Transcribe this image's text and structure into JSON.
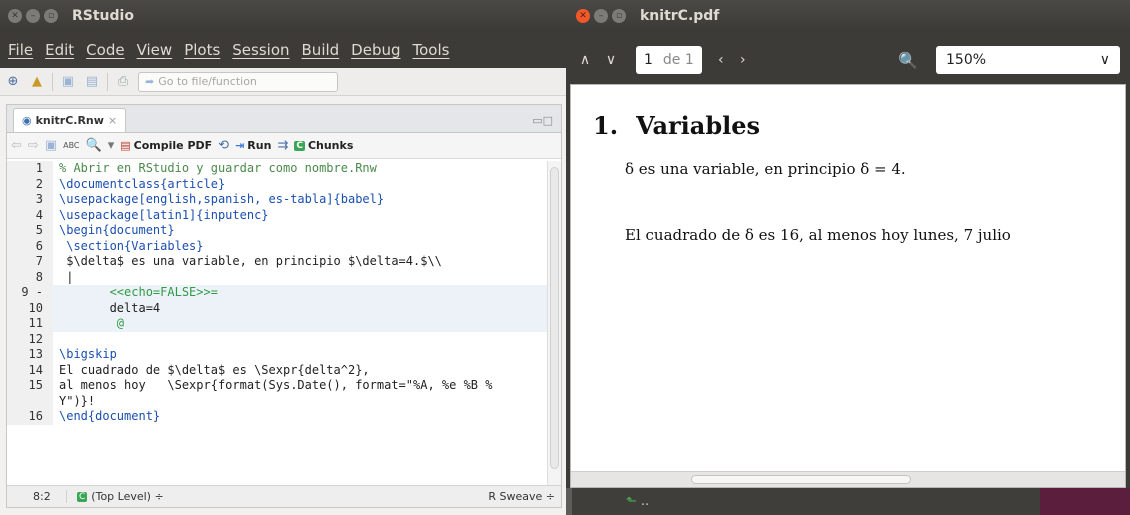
{
  "rstudio": {
    "title": "RStudio",
    "menu": [
      "File",
      "Edit",
      "Code",
      "View",
      "Plots",
      "Session",
      "Build",
      "Debug",
      "Tools"
    ],
    "goto_placeholder": "Go to file/function",
    "file_tab": "knitrC.Rnw",
    "editor_toolbar": {
      "abc": "ABC",
      "compile": "Compile PDF",
      "run": "Run",
      "chunks": "Chunks"
    },
    "code_lines": [
      {
        "num": "1",
        "text": "% Abrir en RStudio y guardar como nombre.Rnw"
      },
      {
        "num": "2",
        "text": "\\documentclass{article}"
      },
      {
        "num": "3",
        "text": "\\usepackage[english,spanish, es-tabla]{babel}"
      },
      {
        "num": "4",
        "text": "\\usepackage[latin1]{inputenc}"
      },
      {
        "num": "5",
        "text": "\\begin{document}"
      },
      {
        "num": "6",
        "text": " \\section{Variables}"
      },
      {
        "num": "7",
        "text": " $\\delta$ es una variable, en principio $\\delta=4.$\\\\"
      },
      {
        "num": "8",
        "text": " |"
      },
      {
        "num": "9 -",
        "text": "       <<echo=FALSE>>="
      },
      {
        "num": "10",
        "text": "       delta=4"
      },
      {
        "num": "11",
        "text": "        @"
      },
      {
        "num": "12",
        "text": ""
      },
      {
        "num": "13",
        "text": "\\bigskip"
      },
      {
        "num": "14",
        "text": "El cuadrado de $\\delta$ es \\Sexpr{delta^2},"
      },
      {
        "num": "15",
        "text": "al menos hoy   \\Sexpr{format(Sys.Date(), format=\"%A, %e %B %"
      },
      {
        "num": "",
        "text": "Y\")}!"
      },
      {
        "num": "16",
        "text": "\\end{document}"
      }
    ],
    "status": {
      "position": "8:2",
      "scope": "(Top Level) ÷",
      "language": "R Sweave ÷"
    }
  },
  "pdf": {
    "title": "knitrC.pdf",
    "page": "1",
    "of": "de 1",
    "zoom": "150%",
    "section_num": "1.",
    "section_title": "Variables",
    "para1": "δ es una variable, en principio δ = 4.",
    "para2": "El cuadrado de δ es 16, al menos hoy lunes, 7 julio"
  }
}
